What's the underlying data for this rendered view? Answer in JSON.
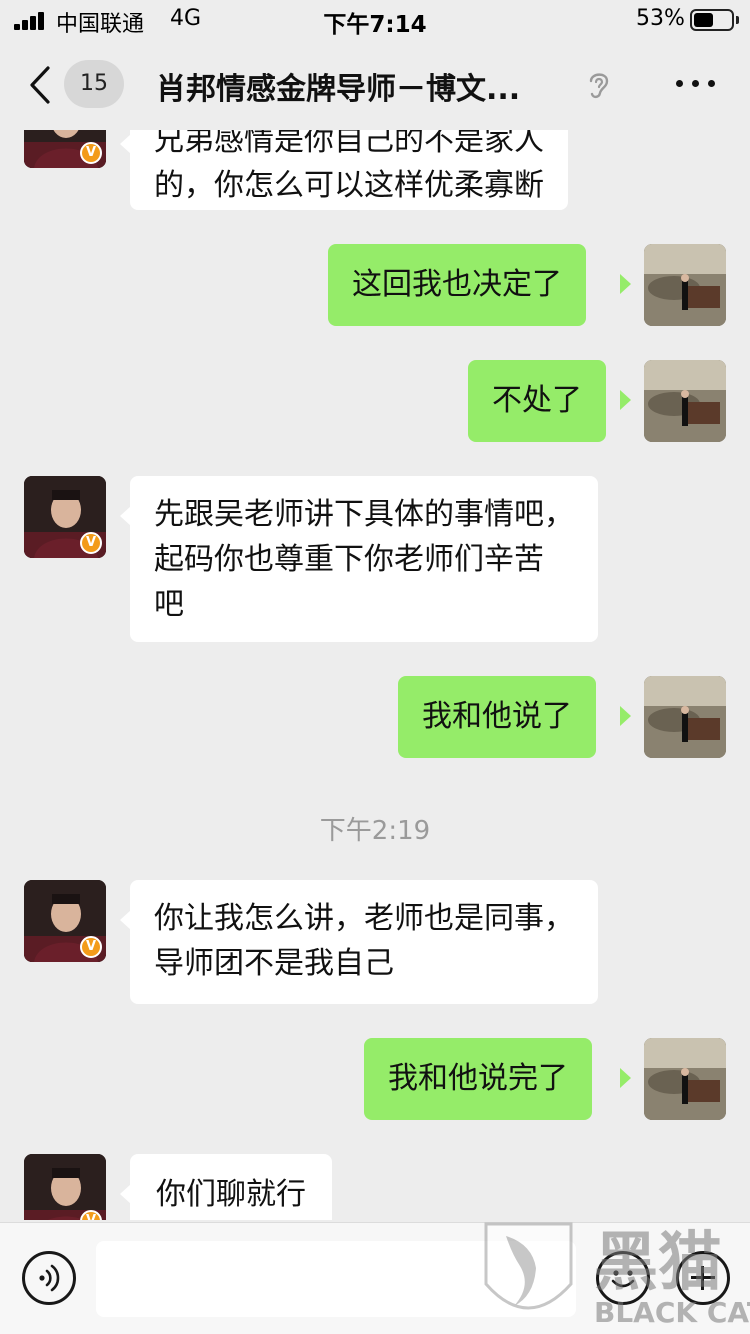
{
  "status_bar": {
    "carrier": "中国联通",
    "network": "4G",
    "time": "下午7:14",
    "battery_percent": "53%",
    "battery_level": 0.53
  },
  "nav": {
    "unread_count": "15",
    "title": "肖邦情感金牌导师－博文...",
    "back_icon": "chevron-left-icon",
    "ear_icon": "ear-icon",
    "more_icon": "more-dots-icon"
  },
  "messages": [
    {
      "side": "in",
      "lines": [
        "兄弟感情是你自己的不是家人",
        "的，你怎么可以这样优柔寡断"
      ]
    },
    {
      "side": "out",
      "lines": [
        "这回我也决定了"
      ]
    },
    {
      "side": "out",
      "lines": [
        "不处了"
      ]
    },
    {
      "side": "in",
      "lines": [
        "先跟吴老师讲下具体的事情吧，",
        "起码你也尊重下你老师们辛苦",
        "吧"
      ]
    },
    {
      "side": "out",
      "lines": [
        "我和他说了"
      ]
    },
    {
      "type": "timestamp",
      "text": "下午2:19"
    },
    {
      "side": "in",
      "lines": [
        "你让我怎么讲，老师也是同事，",
        "导师团不是我自己"
      ]
    },
    {
      "side": "out",
      "lines": [
        "我和他说完了"
      ]
    },
    {
      "side": "in",
      "lines": [
        "你们聊就行"
      ]
    }
  ],
  "avatar_badge": "V",
  "input_bar": {
    "placeholder": "",
    "voice_icon": "voice-icon",
    "emoji_icon": "emoji-icon",
    "plus_icon": "plus-icon"
  },
  "watermark": {
    "text_cn": "黑猫",
    "text_en": "BLACK CAT"
  },
  "colors": {
    "background": "#ededed",
    "bubble_out": "#95ec69",
    "bubble_in": "#ffffff",
    "badge": "#f39b1a"
  }
}
